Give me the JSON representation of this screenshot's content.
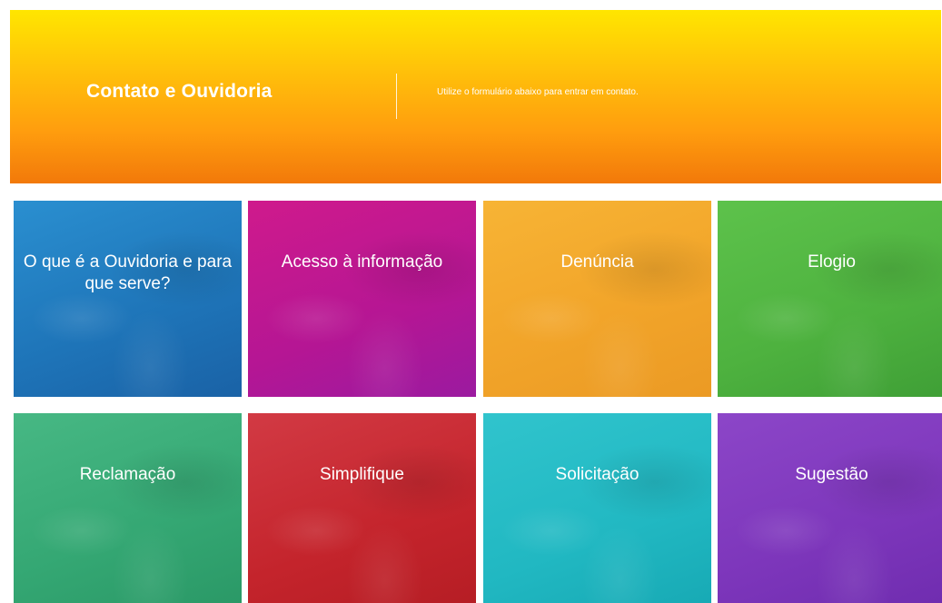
{
  "header": {
    "title": "Contato e Ouvidoria",
    "subtitle": "Utilize o formulário abaixo para entrar em contato.",
    "colors": {
      "top": "#ffe600",
      "bottom": "#f2790a"
    }
  },
  "cards": [
    {
      "label": "O que é a Ouvidoria e para que serve?",
      "color": "#1e74b8"
    },
    {
      "label": "Acesso à informação",
      "color": "#b51694"
    },
    {
      "label": "Denúncia",
      "color": "#f2a52a"
    },
    {
      "label": "Elogio",
      "color": "#4eb23f"
    },
    {
      "label": "Reclamação",
      "color": "#34a773"
    },
    {
      "label": "Simplifique",
      "color": "#c4242c"
    },
    {
      "label": "Solicitação",
      "color": "#21b8c2"
    },
    {
      "label": "Sugestão",
      "color": "#7d36bb"
    }
  ]
}
